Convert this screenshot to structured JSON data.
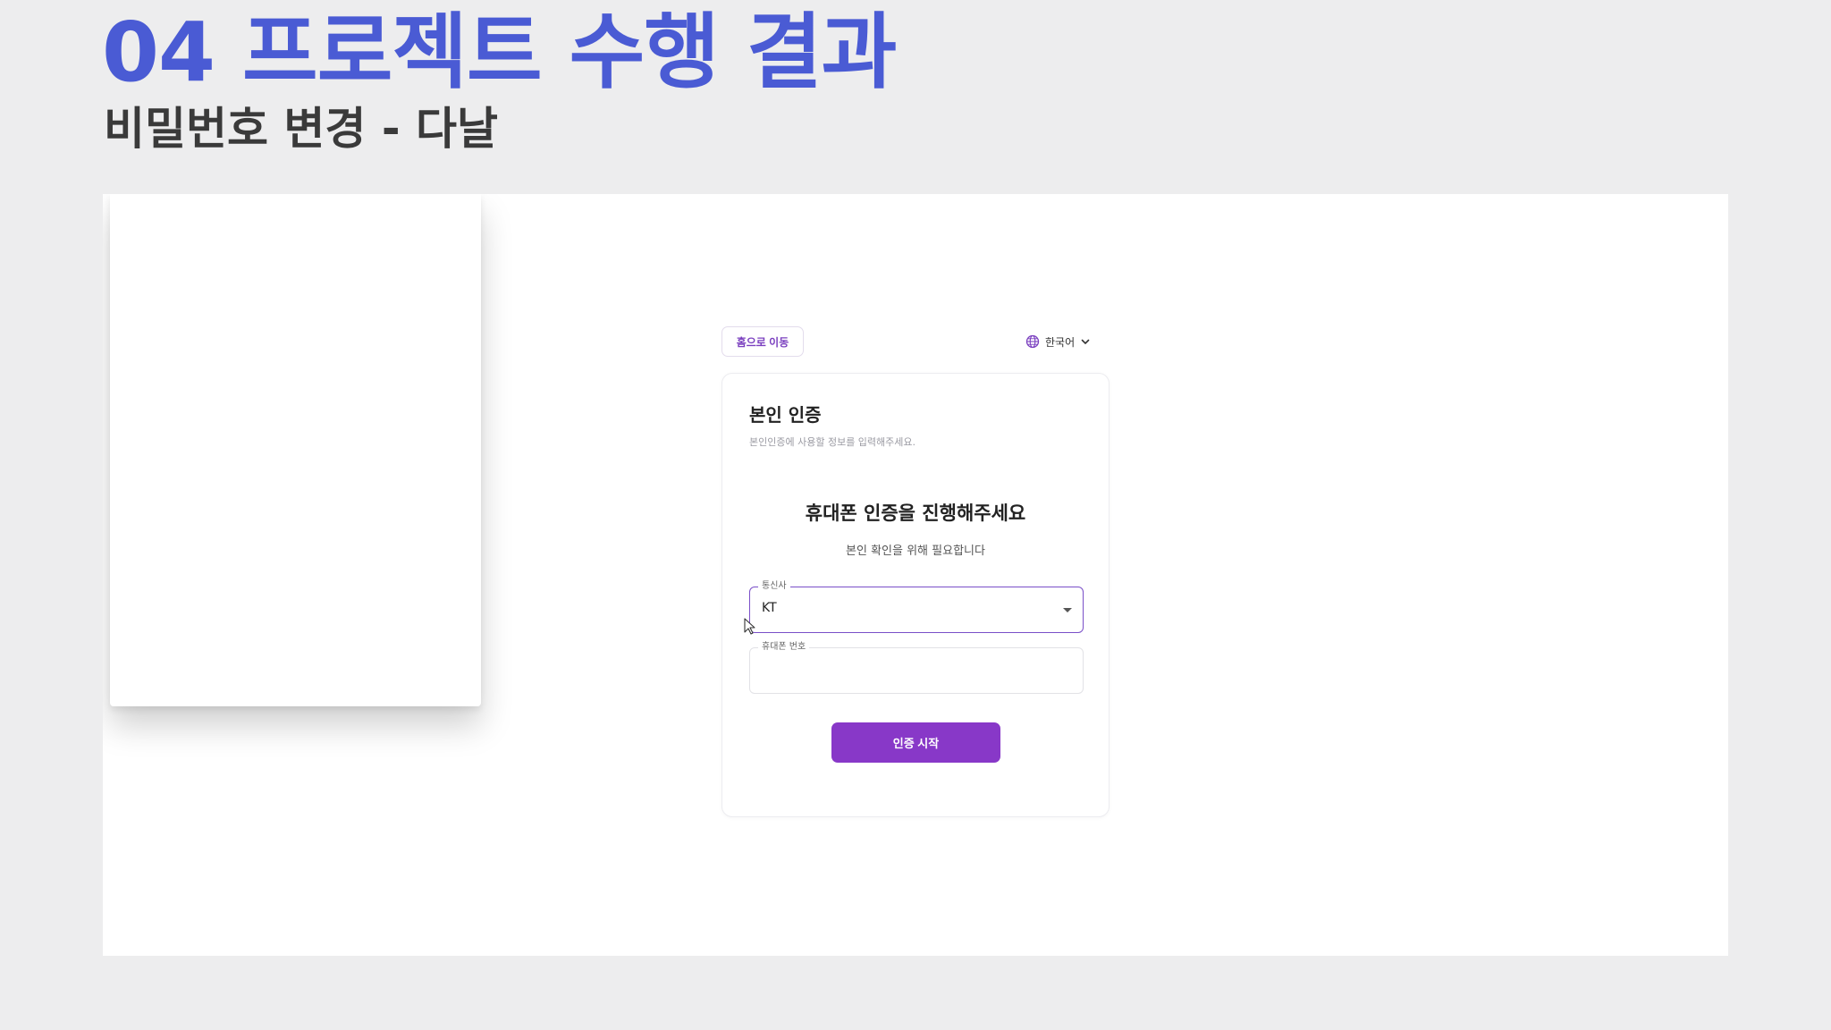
{
  "slide": {
    "title": "04 프로젝트 수행 결과",
    "subtitle": "비밀번호 변경 - 다날"
  },
  "app": {
    "home_button": "홈으로 이동",
    "language": {
      "icon": "globe-icon",
      "selected": "한국어",
      "chevron_icon": "chevron-down-icon"
    },
    "card": {
      "title": "본인 인증",
      "description": "본인인증에 사용할 정보를 입력해주세요.",
      "heading": "휴대폰 인증을 진행해주세요",
      "subheading": "본인 확인을 위해 필요합니다",
      "carrier_field": {
        "label": "통신사",
        "value": "KT",
        "icon": "dropdown-arrow-icon"
      },
      "phone_field": {
        "label": "휴대폰 번호",
        "value": ""
      },
      "submit_button": "인증 시작"
    }
  },
  "colors": {
    "title": "#4a5bd4",
    "accent": "#8838c8",
    "background": "#ededee"
  }
}
